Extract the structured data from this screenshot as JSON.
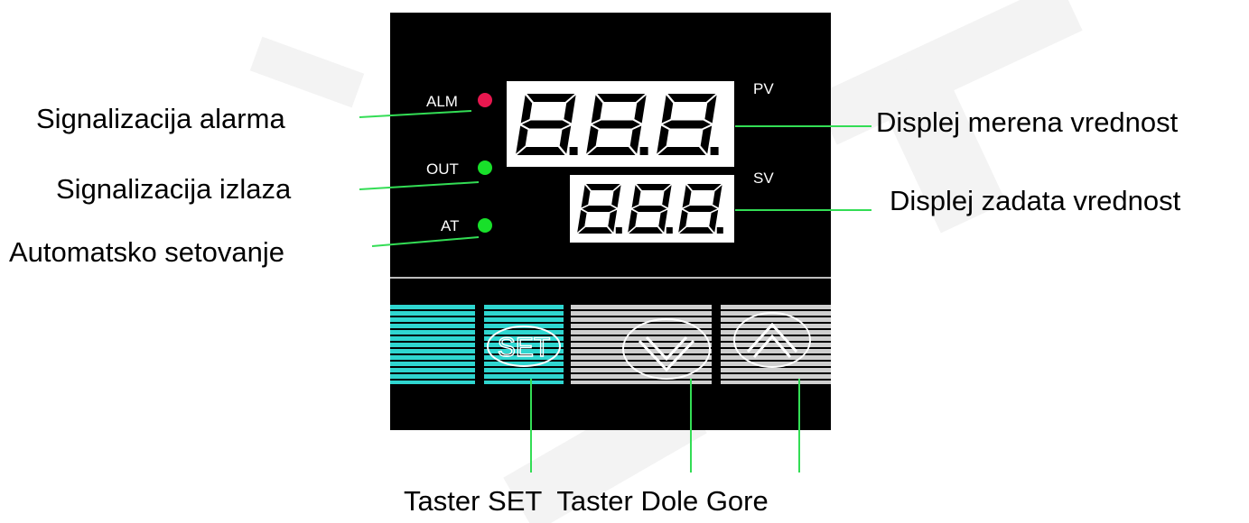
{
  "colors": {
    "panel": "#000000",
    "alarm_led": "#e8174f",
    "output_led": "#18e02a",
    "at_led": "#18e02a",
    "leader_line": "#33dd55",
    "set_button": "#2fd6d0",
    "arrow_buttons": "#cfcfcf"
  },
  "controller": {
    "indicators": [
      {
        "label": "ALM",
        "state": "on",
        "led_color": "#e8174f"
      },
      {
        "label": "OUT",
        "state": "on",
        "led_color": "#18e02a"
      },
      {
        "label": "AT",
        "state": "on",
        "led_color": "#18e02a"
      }
    ],
    "pv_display": {
      "label": "PV",
      "reading": "8.8.8."
    },
    "sv_display": {
      "label": "SV",
      "reading": "8.8.8."
    },
    "buttons": {
      "set": {
        "label": "SET"
      },
      "down": {
        "icon": "chevron-down-icon"
      },
      "up": {
        "icon": "chevron-up-icon"
      }
    }
  },
  "callouts": {
    "alarm": "Signalizacija alarma",
    "output": "Signalizacija izlaza",
    "auto_tune": "Automatsko setovanje",
    "pv": "Displej merena vrednost",
    "sv": "Displej zadata vrednost",
    "bottom": "Taster SET  Taster Dole Gore"
  }
}
